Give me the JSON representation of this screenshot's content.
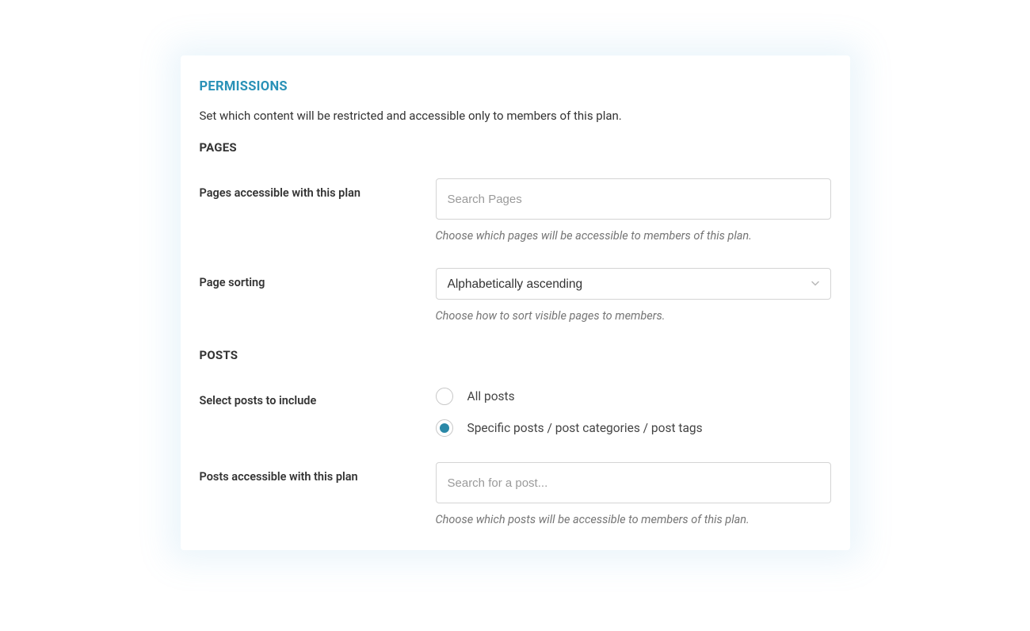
{
  "title": "PERMISSIONS",
  "description": "Set which content will be restricted and accessible only to members of this plan.",
  "pages": {
    "heading": "PAGES",
    "accessible": {
      "label": "Pages accessible with this plan",
      "placeholder": "Search Pages",
      "hint": "Choose which pages will be accessible to members of this plan."
    },
    "sorting": {
      "label": "Page sorting",
      "selected": "Alphabetically ascending",
      "hint": "Choose how to sort visible pages to members."
    }
  },
  "posts": {
    "heading": "POSTS",
    "include": {
      "label": "Select posts to include",
      "options": {
        "all": "All posts",
        "specific": "Specific posts / post categories / post tags"
      },
      "selected": "specific"
    },
    "accessible": {
      "label": "Posts accessible with this plan",
      "placeholder": "Search for a post...",
      "hint": "Choose which posts will be accessible to members of this plan."
    }
  }
}
